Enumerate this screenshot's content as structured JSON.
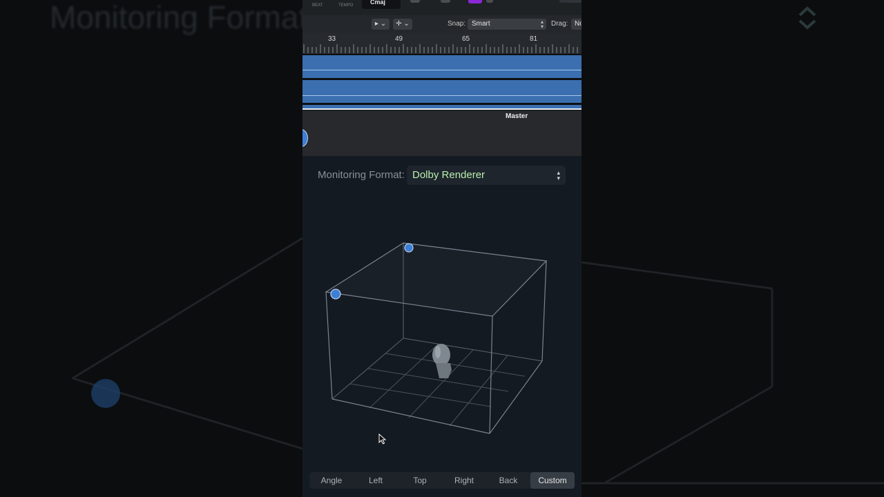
{
  "backdrop": {
    "title_text": "Monitoring Format"
  },
  "toolbar": {
    "beat_label": "BEAT",
    "tempo_label": "TEMPO",
    "key_value": "Cmaj",
    "pointer_tool": "▸ ⌄",
    "marquee_tool": "✛ ⌄",
    "snap_label": "Snap:",
    "snap_value": "Smart",
    "drag_label": "Drag:",
    "drag_value": "No"
  },
  "ruler": {
    "bars": [
      "33",
      "49",
      "65",
      "81"
    ]
  },
  "master_track": {
    "label": "Master"
  },
  "monitoring": {
    "label": "Monitoring Format:",
    "value": "Dolby Renderer"
  },
  "views": {
    "buttons": [
      "Angle",
      "Left",
      "Top",
      "Right",
      "Back",
      "Custom"
    ],
    "selected": "Custom"
  },
  "colors": {
    "accent_blue": "#3d7fd6",
    "region_blue": "#3b6fb0",
    "format_value_green": "#b8efb0",
    "key_purple": "#8b28d6"
  }
}
